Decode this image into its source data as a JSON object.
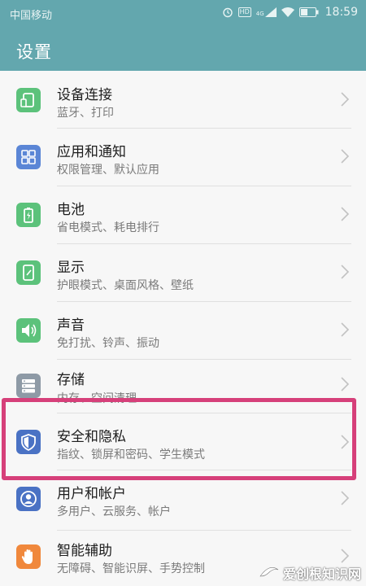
{
  "status_bar": {
    "carrier": "中国移动",
    "time": "18:59",
    "hd_label": "HD",
    "network_label": "4G"
  },
  "header": {
    "title": "设置"
  },
  "settings_items": [
    {
      "title": "设备连接",
      "subtitle": "蓝牙、打印",
      "icon": "device-connection-icon",
      "color": "#5cc27b"
    },
    {
      "title": "应用和通知",
      "subtitle": "权限管理、默认应用",
      "icon": "apps-grid-icon",
      "color": "#5b86d6"
    },
    {
      "title": "电池",
      "subtitle": "省电模式、耗电排行",
      "icon": "battery-icon",
      "color": "#5cc27b"
    },
    {
      "title": "显示",
      "subtitle": "护眼模式、桌面风格、壁纸",
      "icon": "display-icon",
      "color": "#5cc27b"
    },
    {
      "title": "声音",
      "subtitle": "免打扰、铃声、振动",
      "icon": "speaker-icon",
      "color": "#5cc27b"
    },
    {
      "title": "存储",
      "subtitle": "内存、空间清理",
      "icon": "storage-icon",
      "color": "#8e9aa6"
    },
    {
      "title": "安全和隐私",
      "subtitle": "指纹、锁屏和密码、学生模式",
      "icon": "shield-icon",
      "color": "#4a72c4"
    },
    {
      "title": "用户和帐户",
      "subtitle": "多用户、云服务、帐户",
      "icon": "user-icon",
      "color": "#4a72c4"
    },
    {
      "title": "智能辅助",
      "subtitle": "无障碍、智能识屏、手势控制",
      "icon": "hand-icon",
      "color": "#f0883c"
    }
  ],
  "watermark": {
    "text": "爱创根知识网"
  },
  "colors": {
    "header": "#63a7ae",
    "highlight": "#d6407a"
  }
}
